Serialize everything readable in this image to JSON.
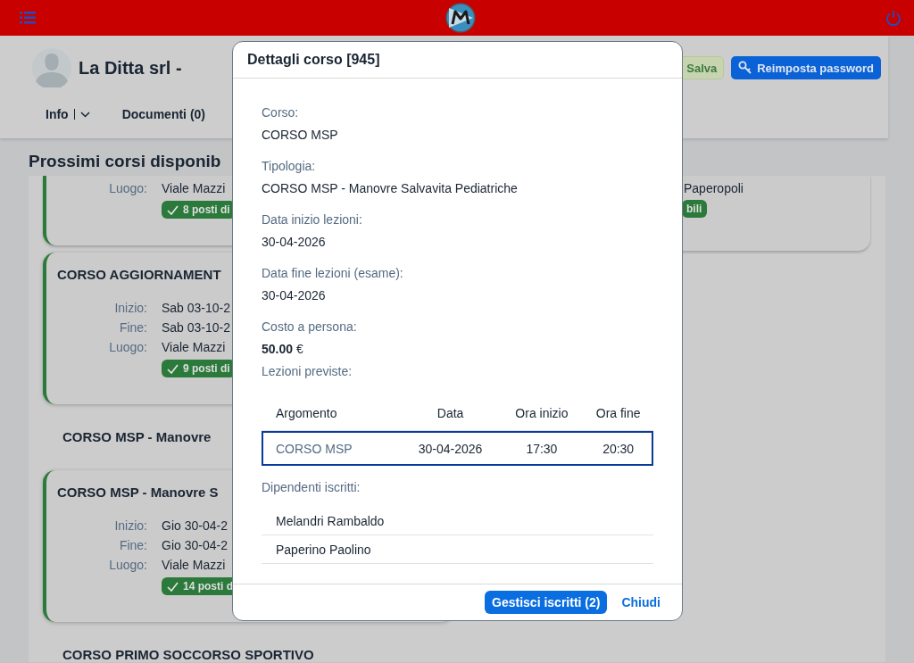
{
  "profile": {
    "name": "La Ditta srl -",
    "buttons": [
      {
        "label": "Salva",
        "kind": "save"
      },
      {
        "label": "Reimposta password",
        "kind": "primary"
      }
    ]
  },
  "tabs": [
    {
      "label": "Info",
      "kind": "menu"
    },
    {
      "label": "Documenti (0)",
      "kind": "plain"
    }
  ],
  "section_title": "Prossimi corsi disponib",
  "courses": [
    {
      "kind": "card",
      "fields": [
        {
          "label": "Luogo:",
          "value": "Viale Mazzi"
        }
      ],
      "badge": "8 posti di"
    },
    {
      "kind": "card",
      "title": "CORSO AGGIORNAMENT",
      "fields": [
        {
          "label": "Inizio:",
          "value": "Sab 03-10-2"
        },
        {
          "label": "Fine:",
          "value": "Sab 03-10-2"
        },
        {
          "label": "Luogo:",
          "value": "Viale Mazzi"
        }
      ],
      "badge": "9 posti di"
    },
    {
      "kind": "heading",
      "title": "CORSO MSP - Manovre"
    },
    {
      "kind": "card",
      "title": "CORSO MSP - Manovre S",
      "fields": [
        {
          "label": "Inizio:",
          "value": "Gio 30-04-2"
        },
        {
          "label": "Fine:",
          "value": "Gio 30-04-2"
        },
        {
          "label": "Luogo:",
          "value": "Viale Mazzi"
        }
      ],
      "badge": "14 posti d"
    },
    {
      "kind": "heading",
      "title": "CORSO PRIMO SOCCORSO SPORTIVO"
    }
  ],
  "side_card": {
    "place": "Paperopoli",
    "badge": "bili"
  },
  "modal": {
    "title": "Dettagli corso [945]",
    "fields": [
      {
        "label": "Corso:",
        "value": "CORSO MSP"
      },
      {
        "label": "Tipologia:",
        "value": "CORSO MSP - Manovre Salvavita Pediatriche"
      },
      {
        "label": "Data inizio lezioni:",
        "value": "30-04-2026"
      },
      {
        "label": "Data fine lezioni (esame):",
        "value": "30-04-2026"
      },
      {
        "label": "Costo a persona:",
        "value": "**50.00** €"
      }
    ],
    "lessons_label": "Lezioni previste:",
    "lessons": {
      "columns": [
        "Argomento",
        "Data",
        "Ora inizio",
        "Ora fine"
      ],
      "rows": [
        {
          "cells": [
            "CORSO MSP",
            "30-04-2026",
            "17:30",
            "20:30"
          ],
          "selected": true
        }
      ]
    },
    "enrolled_label": "Dipendenti iscritti:",
    "enrolled": [
      "Melandri Rambaldo",
      "Paperino Paolino"
    ],
    "buttons": [
      {
        "label": "Gestisci iscritti (2)",
        "kind": "primary"
      },
      {
        "label": "Chiudi",
        "kind": "link"
      }
    ]
  }
}
